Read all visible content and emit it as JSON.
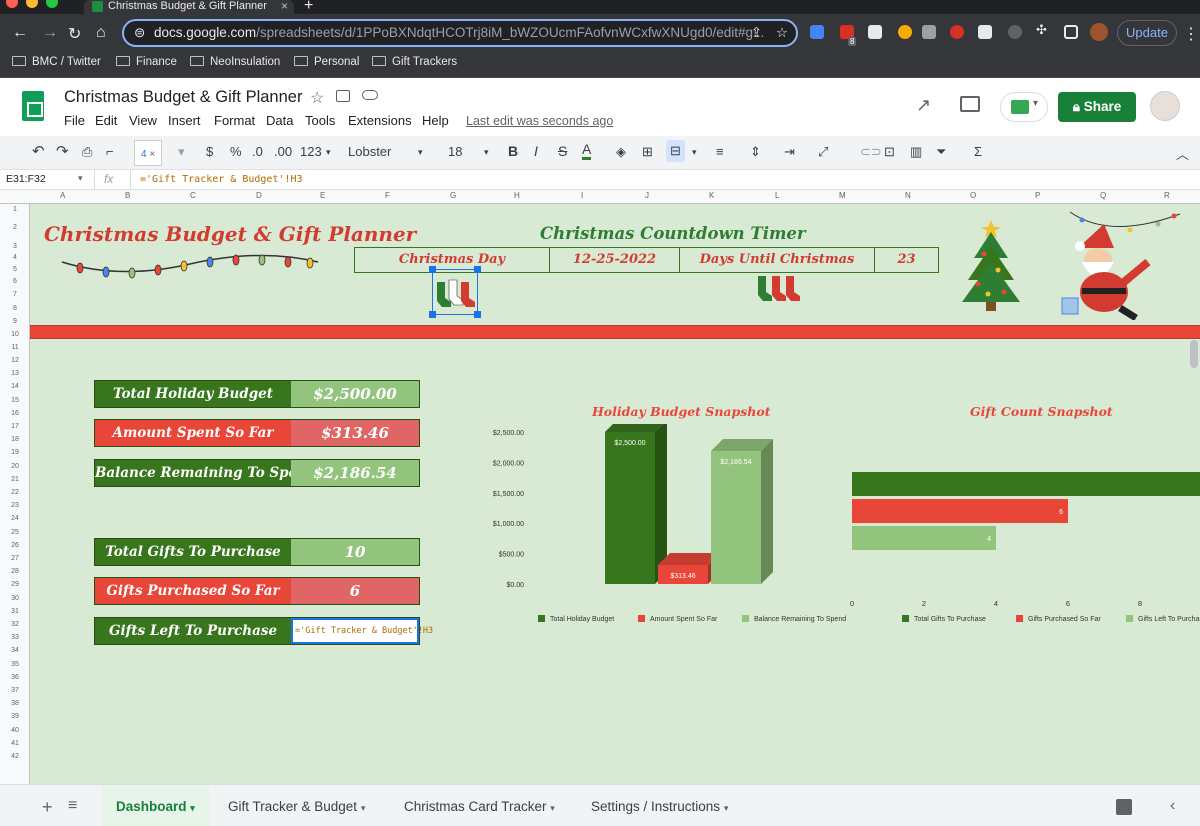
{
  "browser": {
    "tab_title": "Christmas Budget & Gift Planner",
    "url_host": "docs.google.com",
    "url_path": "/spreadsheets/d/1PPoBXNdqtHCOTrj8iM_bWZOUcmFAofvnWCxfwXNUgd0/edit#g...",
    "update_label": "Update",
    "extension_badge": "8",
    "bookmarks": [
      "BMC / Twitter",
      "Finance",
      "NeoInsulation",
      "Personal",
      "Gift Trackers"
    ]
  },
  "doc": {
    "title": "Christmas Budget & Gift Planner",
    "menu": [
      "File",
      "Edit",
      "View",
      "Insert",
      "Format",
      "Data",
      "Tools",
      "Extensions",
      "Help"
    ],
    "last_edit": "Last edit was seconds ago",
    "share_label": "Share"
  },
  "format_toolbar": {
    "zoom_hint": "4",
    "currency": "$",
    "percent": "%",
    "dec_less": ".0",
    "dec_more": ".00",
    "number_format": "123",
    "font": "Lobster",
    "font_size": "18"
  },
  "formula_bar": {
    "name_box": "E31:F32",
    "fx": "fx",
    "formula": "='Gift Tracker & Budget'!H3"
  },
  "grid": {
    "columns": [
      "A",
      "B",
      "C",
      "D",
      "E",
      "F",
      "G",
      "H",
      "I",
      "J",
      "K",
      "L",
      "M",
      "N",
      "O",
      "P",
      "Q",
      "R"
    ],
    "rows": [
      "1",
      "2",
      "3",
      "4",
      "5",
      "6",
      "7",
      "8",
      "9",
      "10",
      "11",
      "12",
      "13",
      "14",
      "15",
      "16",
      "17",
      "18",
      "19",
      "20",
      "21",
      "22",
      "23",
      "24",
      "25",
      "26",
      "27",
      "28",
      "29",
      "30",
      "31",
      "32",
      "33",
      "34",
      "35",
      "36",
      "37",
      "38",
      "39",
      "40",
      "41",
      "42"
    ]
  },
  "dashboard": {
    "title": "Christmas Budget & Gift Planner",
    "countdown_title": "Christmas Countdown Timer",
    "countdown": {
      "christmas_day_label": "Christmas Day",
      "date": "12-25-2022",
      "days_until_label": "Days Until Christmas",
      "days": "23"
    },
    "budget": [
      {
        "label": "Total Holiday Budget",
        "value": "$2,500.00"
      },
      {
        "label": "Amount Spent So Far",
        "value": "$313.46"
      },
      {
        "label": "Balance Remaining To Spend",
        "value": "$2,186.54"
      }
    ],
    "gifts": [
      {
        "label": "Total Gifts To Purchase",
        "value": "10"
      },
      {
        "label": "Gifts Purchased So Far",
        "value": "6"
      },
      {
        "label": "Gifts Left To Purchase",
        "value": "='Gift Tracker & Budget'!H3"
      }
    ]
  },
  "colors": {
    "dark_green": "#38761d",
    "light_green": "#93c47d",
    "red": "#e84639",
    "light_red": "#e06666",
    "sheet_bg": "#d8ead3"
  },
  "chart_data": [
    {
      "type": "bar",
      "title": "Holiday Budget Snapshot",
      "categories": [
        "Total Holiday Budget",
        "Amount Spent So Far",
        "Balance Remaining To Spend"
      ],
      "values": [
        2500,
        313.46,
        2186.54
      ],
      "data_labels": [
        "$2,500.00",
        "$313.46",
        "$2,186.54"
      ],
      "colors": [
        "#38761d",
        "#e84639",
        "#93c47d"
      ],
      "yticks": [
        "$0.00",
        "$500.00",
        "$1,000.00",
        "$1,500.00",
        "$2,000.00",
        "$2,500.00"
      ],
      "ylim": [
        0,
        2500
      ],
      "legend": "bottom"
    },
    {
      "type": "bar",
      "orientation": "horizontal",
      "title": "Gift Count Snapshot",
      "categories": [
        "Total Gifts To Purchase",
        "Gifts Purchased So Far",
        "Gifts Left To Purchase"
      ],
      "values": [
        10,
        6,
        4
      ],
      "data_labels": [
        "",
        "6",
        "4"
      ],
      "colors": [
        "#38761d",
        "#e84639",
        "#93c47d"
      ],
      "xticks": [
        "0",
        "2",
        "4",
        "6",
        "8"
      ],
      "xlim": [
        0,
        8
      ],
      "legend": "bottom"
    }
  ],
  "sheet_tabs": [
    "Dashboard",
    "Gift Tracker & Budget",
    "Christmas Card Tracker",
    "Settings / Instructions"
  ]
}
